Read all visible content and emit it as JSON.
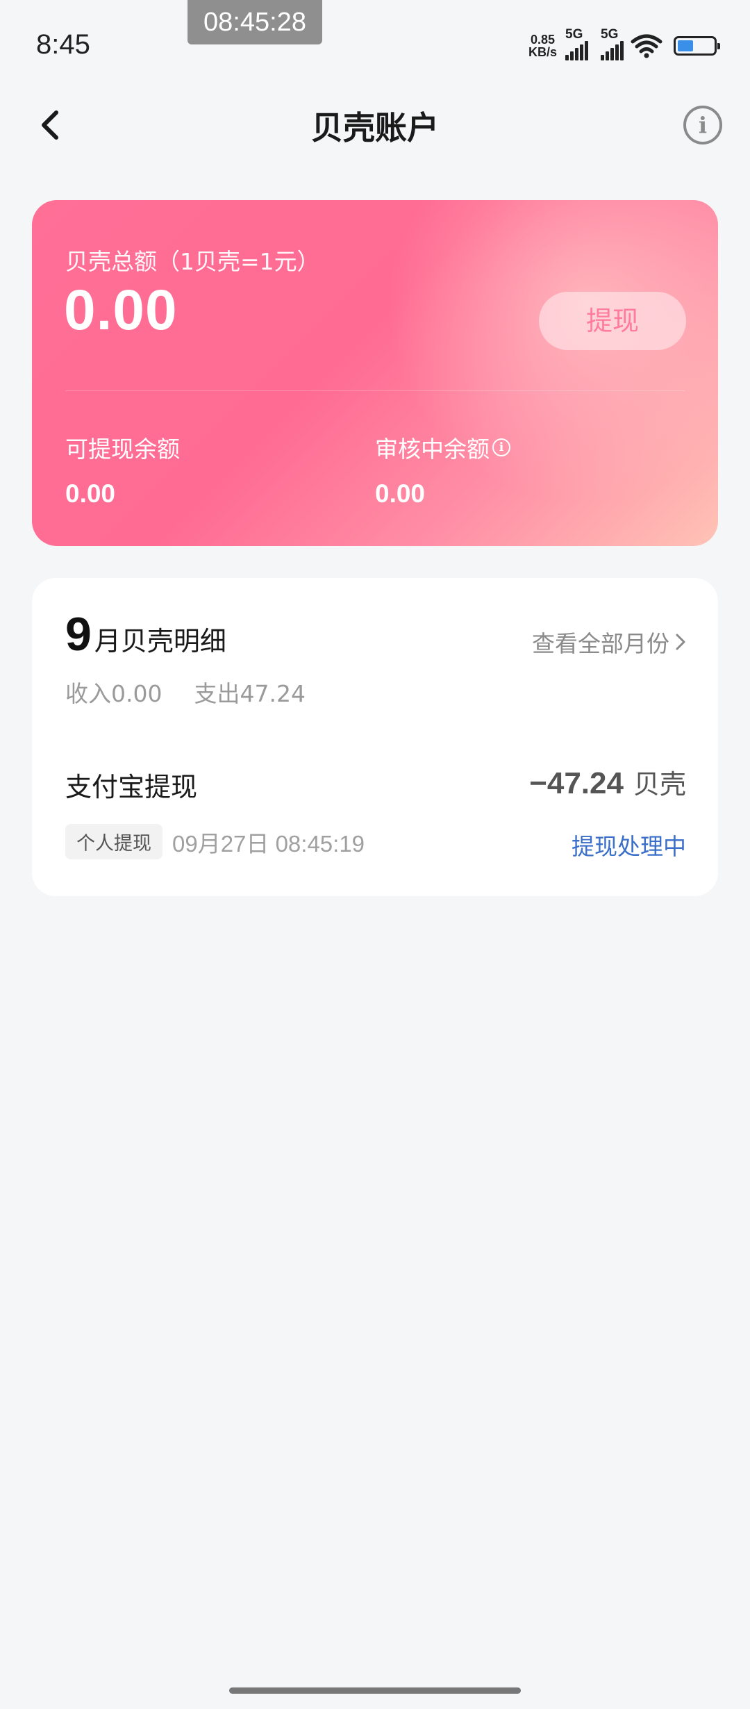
{
  "status_bar": {
    "time": "8:45",
    "screen_timer": "08:45:28",
    "net_speed_value": "0.85",
    "net_speed_unit": "KB/s",
    "sim1_label": "5G",
    "sim2_label": "5G",
    "wifi_icon": "wifi-icon",
    "battery_icon": "battery-icon",
    "battery_color": "#3a8fe8"
  },
  "nav": {
    "title": "贝壳账户",
    "back_icon": "chevron-left-icon",
    "info_icon": "info-icon",
    "info_glyph": "i"
  },
  "balance": {
    "total_label": "贝壳总额（1贝壳=1元）",
    "total_value": "0.00",
    "withdraw_label": "提现",
    "withdrawable_label": "可提现余额",
    "withdrawable_value": "0.00",
    "pending_label": "审核中余额",
    "pending_value": "0.00",
    "pending_info_glyph": "i",
    "card_color": "#ff6f96"
  },
  "detail": {
    "month_number": "9",
    "month_title": "月贝壳明细",
    "view_all_label": "查看全部月份",
    "income": "收入0.00",
    "expense": "支出47.24",
    "transactions": [
      {
        "title": "支付宝提现",
        "amount": "−47.24",
        "unit": "贝壳",
        "tag": "个人提现",
        "time": "09月27日 08:45:19",
        "status": "提现处理中",
        "status_color": "#3b6fc9"
      }
    ]
  }
}
